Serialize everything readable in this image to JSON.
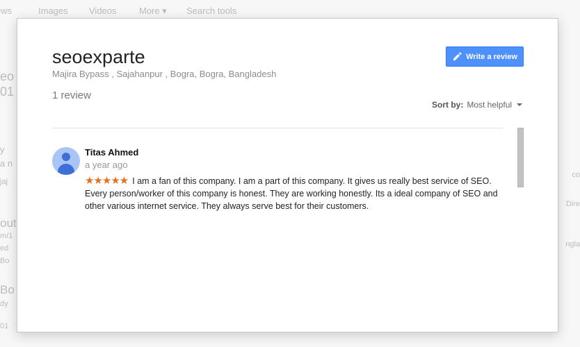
{
  "background": {
    "nav": [
      "ews",
      "Images",
      "Videos",
      "More ▾",
      "Search tools"
    ],
    "side": [
      "eo",
      "01",
      "y",
      "a n",
      "jaj",
      "out",
      "m/1",
      "ed",
      "Bo",
      "Bo",
      "dy",
      "01"
    ],
    "right": [
      "co",
      "Dire",
      "ngla"
    ]
  },
  "business": {
    "name": "seoexparte",
    "address": "Majira Bypass , Sajahanpur , Bogra, Bogra, Bangladesh",
    "review_count": "1 review"
  },
  "toolbar": {
    "write_review_label": "Write a review",
    "sort_label": "Sort by:",
    "sort_value": "Most helpful"
  },
  "reviews": [
    {
      "author": "Titas Ahmed",
      "time": "a year ago",
      "rating": 5,
      "stars": "★★★★★",
      "text": "I am a fan of this company. I am a part of this company. It gives us really best service of SEO. Every person/worker of this company is honest. They are working honestly. Its a ideal company of SEO and other various internet service. They always serve best for their customers."
    }
  ],
  "colors": {
    "accent_button": "#4d90fe",
    "star": "#e7711b",
    "avatar_bg": "#a9c4f6",
    "avatar_fg": "#3f6fd6"
  }
}
